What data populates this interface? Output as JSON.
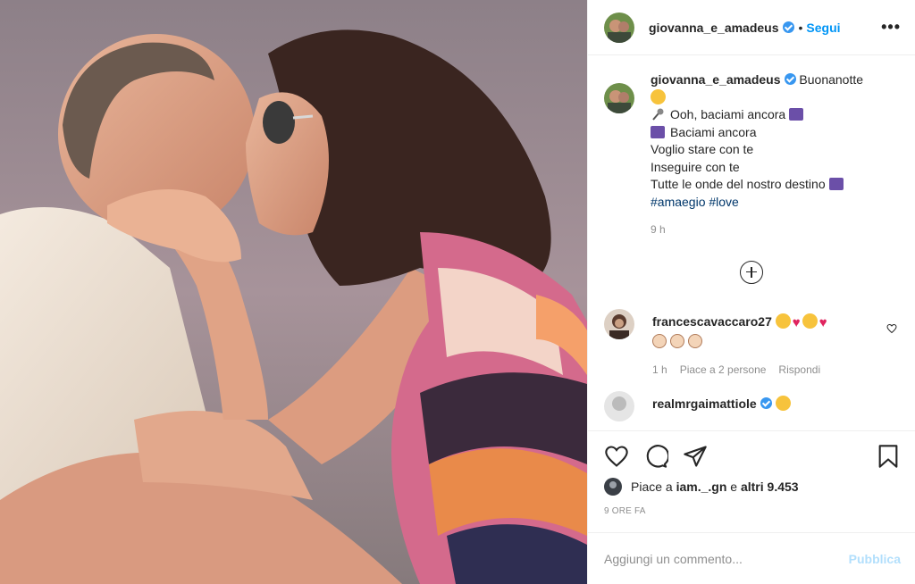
{
  "post": {
    "username": "giovanna_e_amadeus",
    "follow_label": "Segui",
    "dot": "•",
    "more_label": "•••"
  },
  "caption": {
    "username": "giovanna_e_amadeus",
    "first_line": "Buonanotte",
    "lines": [
      "Ooh, baciami ancora",
      "Baciami ancora",
      "Voglio stare con te",
      "Inseguire con te",
      "Tutte le onde del nostro destino"
    ],
    "hashtags": "#amaegio #love",
    "time": "9 h"
  },
  "comments": [
    {
      "username": "francescavaccaro27",
      "time": "1 h",
      "likes_label": "Piace a 2 persone",
      "reply_label": "Rispondi"
    },
    {
      "username": "realmrgaimattiole"
    }
  ],
  "likes": {
    "prefix": "Piace a",
    "user": "iam._.gn",
    "middle": "e",
    "others": "altri 9.453"
  },
  "date": "9 ORE FA",
  "add_comment": {
    "placeholder": "Aggiungi un commento...",
    "publish_label": "Pubblica"
  },
  "colors": {
    "accent": "#0095f6",
    "verified": "#3897f0",
    "publish_disabled": "#b2dffc",
    "secondary_text": "#8e8e8e",
    "hashtag": "#00376b"
  },
  "icons": [
    "verified-badge-icon",
    "more-icon",
    "add-comments-icon",
    "heart-icon",
    "comment-icon",
    "share-icon",
    "bookmark-icon",
    "like-heart-small-icon"
  ]
}
